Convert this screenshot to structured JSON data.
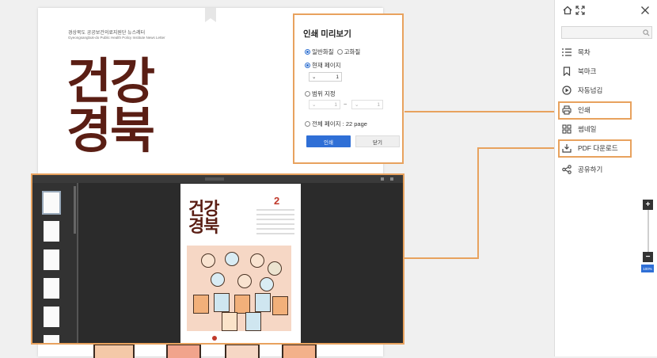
{
  "document": {
    "newsletter_ko": "경상북도 공공보건의료지원단 뉴스레터",
    "newsletter_en": "Gyeongsangbuk-do Public Health Policy Institute News Letter",
    "title_line1": "건강",
    "title_line2": "경북"
  },
  "print_dialog": {
    "title": "인쇄 미리보기",
    "quality_normal": "일반화질",
    "quality_high": "고화질",
    "current_page_label": "현재 페이지",
    "current_page_value": "1",
    "range_label": "범위 지정",
    "range_from": "1",
    "range_tilde": "~",
    "range_to": "1",
    "all_pages_label": "전체 페이지 : 22 page",
    "print_button": "인쇄",
    "close_button": "닫기"
  },
  "viewer": {
    "cover_title_line1": "건강",
    "cover_title_line2": "경북",
    "cover_number": "2"
  },
  "panel": {
    "menu": [
      {
        "label": "목차",
        "icon": "list-icon"
      },
      {
        "label": "북마크",
        "icon": "bookmark-icon"
      },
      {
        "label": "자동넘김",
        "icon": "play-circle-icon"
      },
      {
        "label": "인쇄",
        "icon": "printer-icon"
      },
      {
        "label": "썸네일",
        "icon": "thumbnails-icon"
      },
      {
        "label": "PDF 다운로드",
        "icon": "download-icon"
      },
      {
        "label": "공유하기",
        "icon": "share-icon"
      }
    ],
    "zoom_level": "100%"
  },
  "colors": {
    "accent_highlight": "#e8a25e",
    "primary_button": "#2f6fd6",
    "title_brown": "#5a1e14"
  }
}
